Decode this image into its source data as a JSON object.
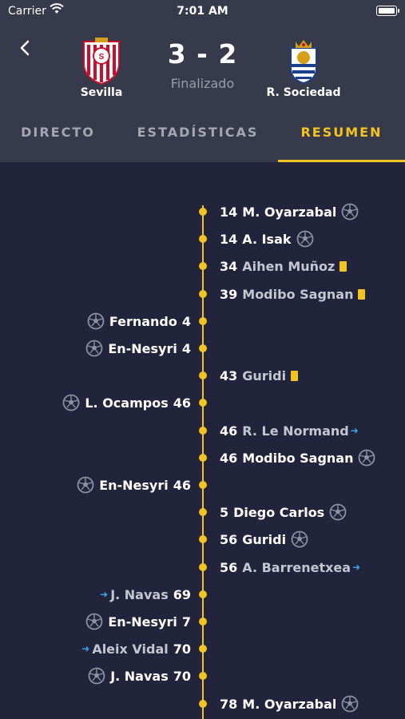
{
  "status_bar": {
    "carrier": "Carrier",
    "time": "7:01 AM"
  },
  "match": {
    "home_team": "Sevilla",
    "away_team": "R. Sociedad",
    "score": "3 - 2",
    "status": "Finalizado",
    "colors": {
      "accent": "#f3c320",
      "header_bg": "#373a4a",
      "body_bg": "#21243b",
      "sub_arrow": "#32a8e8"
    }
  },
  "tabs": [
    {
      "label": "DIRECTO",
      "active": false
    },
    {
      "label": "ESTADÍSTICAS",
      "active": false
    },
    {
      "label": "RESUMEN",
      "active": true
    }
  ],
  "events": [
    {
      "side": "away",
      "minute": "14",
      "player": "M. Oyarzabal",
      "type": "goal"
    },
    {
      "side": "away",
      "minute": "14",
      "player": "A. Isak",
      "type": "goal"
    },
    {
      "side": "away",
      "minute": "34",
      "player": "Aihen Muñoz",
      "type": "yellow-card"
    },
    {
      "side": "away",
      "minute": "39",
      "player": "Modibo Sagnan",
      "type": "yellow-card"
    },
    {
      "side": "home",
      "minute": "4",
      "player": "Fernando",
      "type": "goal"
    },
    {
      "side": "home",
      "minute": "4",
      "player": "En-Nesyri",
      "type": "goal"
    },
    {
      "side": "away",
      "minute": "43",
      "player": "Guridi",
      "type": "yellow-card"
    },
    {
      "side": "home",
      "minute": "46",
      "player": "L. Ocampos",
      "type": "goal"
    },
    {
      "side": "away",
      "minute": "46",
      "player": "R. Le Normand",
      "type": "substitution"
    },
    {
      "side": "away",
      "minute": "46",
      "player": "Modibo Sagnan",
      "type": "goal"
    },
    {
      "side": "home",
      "minute": "46",
      "player": "En-Nesyri",
      "type": "goal"
    },
    {
      "side": "away",
      "minute": "5",
      "player": "Diego Carlos",
      "type": "goal"
    },
    {
      "side": "away",
      "minute": "56",
      "player": "Guridi",
      "type": "goal"
    },
    {
      "side": "away",
      "minute": "56",
      "player": "A. Barrenetxea",
      "type": "substitution"
    },
    {
      "side": "home",
      "minute": "69",
      "player": "J. Navas",
      "type": "substitution"
    },
    {
      "side": "home",
      "minute": "7",
      "player": "En-Nesyri",
      "type": "goal"
    },
    {
      "side": "home",
      "minute": "70",
      "player": "Aleix Vidal",
      "type": "substitution"
    },
    {
      "side": "home",
      "minute": "70",
      "player": "J. Navas",
      "type": "goal"
    },
    {
      "side": "away",
      "minute": "78",
      "player": "M. Oyarzabal",
      "type": "goal"
    }
  ]
}
